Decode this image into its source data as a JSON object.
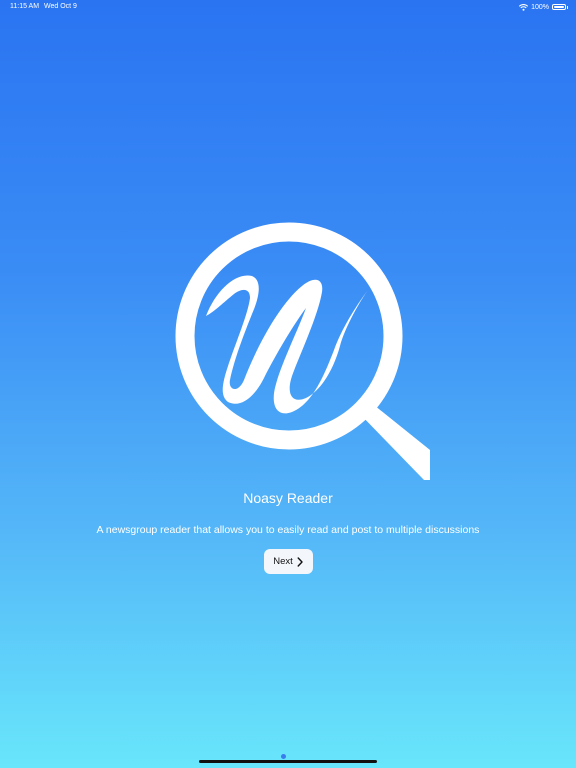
{
  "status_bar": {
    "time": "11:15 AM",
    "date": "Wed Oct 9",
    "battery": "100%"
  },
  "icons": {
    "wifi": "wifi-icon",
    "battery": "battery-icon",
    "logo": "magnifier-n-logo",
    "next": "chevron-right-icon"
  },
  "welcome": {
    "title": "Noasy Reader",
    "subtitle": "A newsgroup reader that allows you to easily read and post to multiple discussions",
    "next_label": "Next"
  },
  "pager": {
    "current_page": 1
  },
  "colors": {
    "gradient_top": "#2a74f2",
    "gradient_bottom": "#68e6fb",
    "button_bg": "#f3f6fb"
  }
}
